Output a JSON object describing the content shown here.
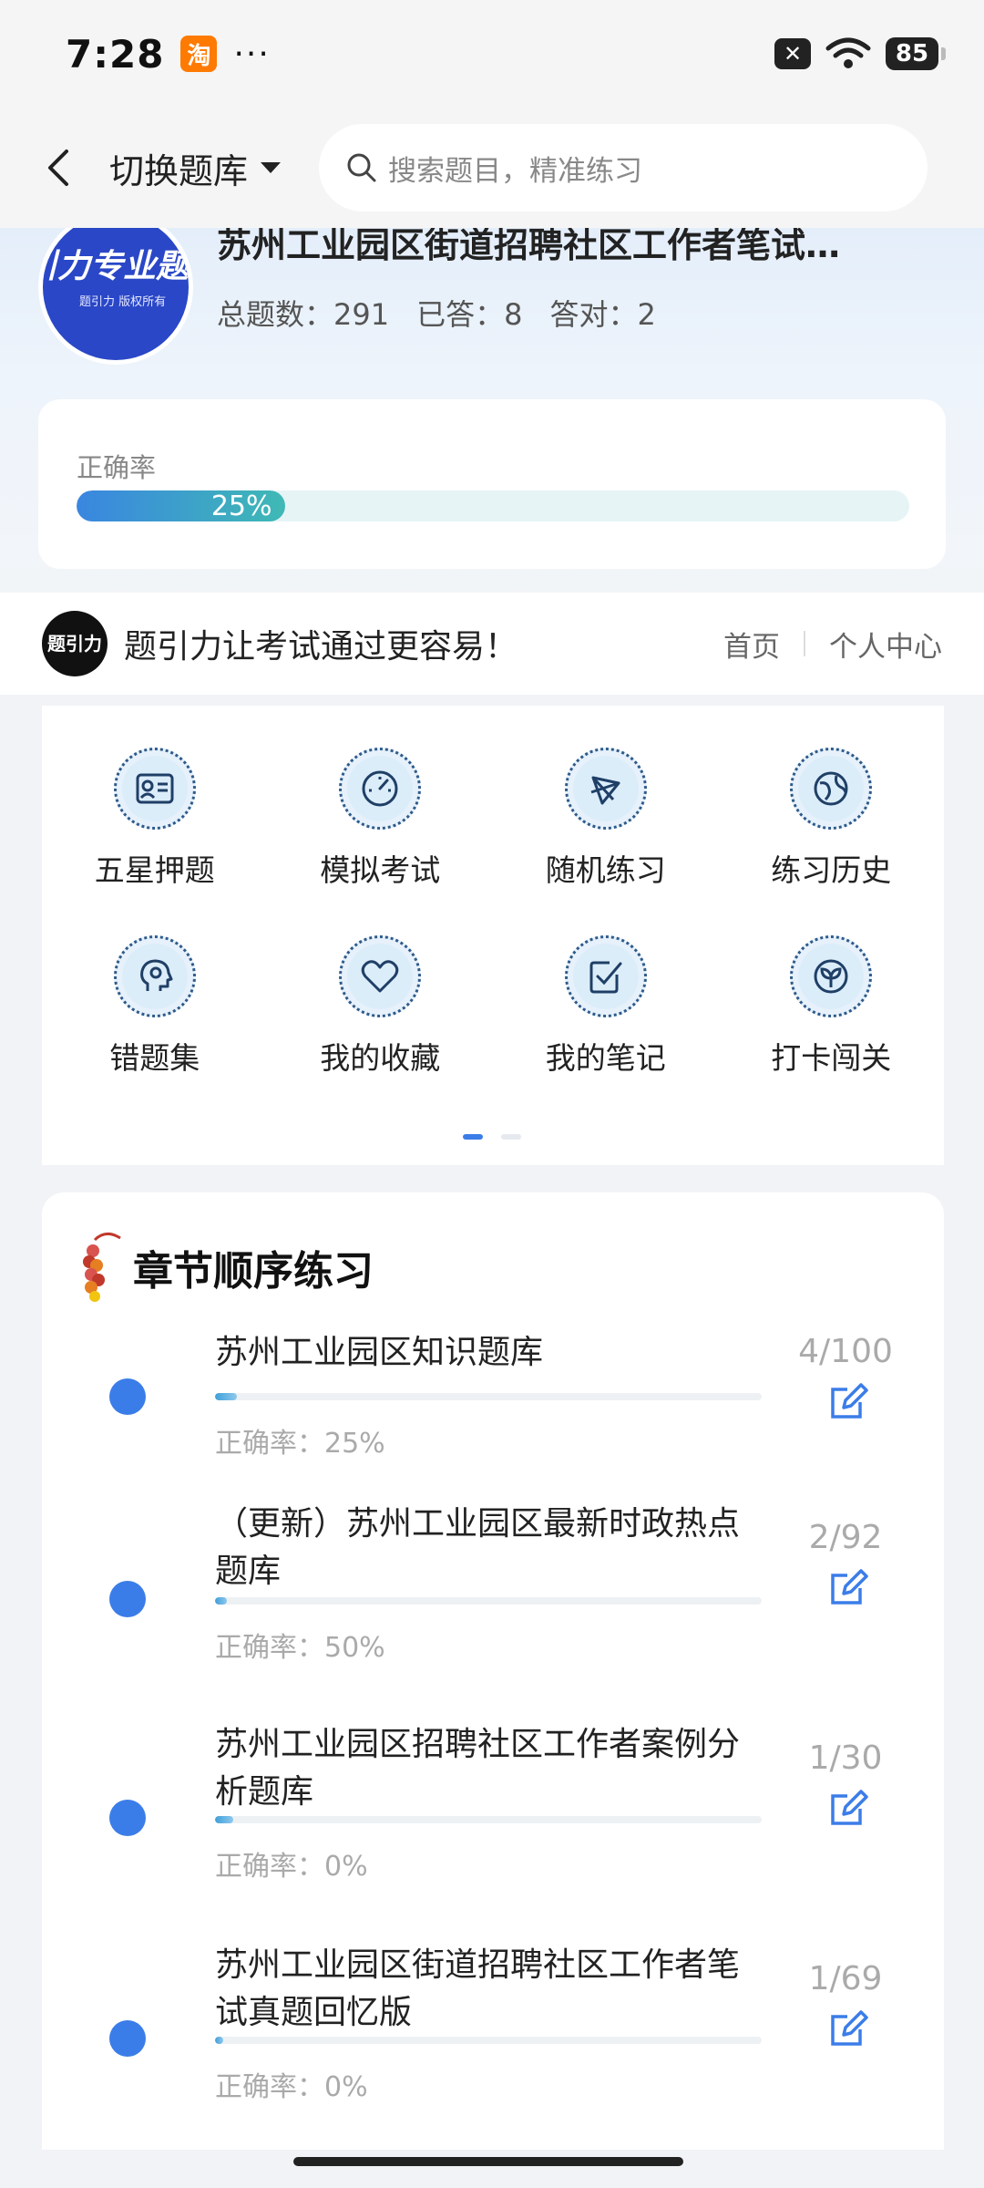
{
  "status_bar": {
    "time": "7:28",
    "app_badge": "淘",
    "dots": "···",
    "battery": "85"
  },
  "nav": {
    "switch_label": "切换题库",
    "search_placeholder": "搜索题目，精准练习"
  },
  "bank": {
    "logo_text": "引力专业题",
    "logo_sub": "题引力 版权所有",
    "title": "苏州工业园区街道招聘社区工作者笔试…",
    "stats": {
      "total": "总题数：291",
      "answered": "已答：8",
      "correct": "答对：2"
    },
    "accuracy_label": "正确率",
    "accuracy_value": "25%",
    "accuracy_fraction": 0.25
  },
  "brand": {
    "logo": "题引力",
    "slogan": "题引力让考试通过更容易！",
    "home": "首页",
    "personal": "个人中心"
  },
  "features": [
    {
      "label": "五星押题",
      "icon": "id-card-icon"
    },
    {
      "label": "模拟考试",
      "icon": "speedometer-icon"
    },
    {
      "label": "随机练习",
      "icon": "shuffle-icon"
    },
    {
      "label": "练习历史",
      "icon": "globe-icon"
    },
    {
      "label": "错题集",
      "icon": "head-icon"
    },
    {
      "label": "我的收藏",
      "icon": "heart-icon"
    },
    {
      "label": "我的笔记",
      "icon": "note-check-icon"
    },
    {
      "label": "打卡闯关",
      "icon": "sprout-icon"
    }
  ],
  "pager": {
    "active_index": 0,
    "count": 2,
    "active_color": "#3b7de8",
    "inactive_color": "#e6e9ee"
  },
  "chapters": {
    "title": "章节顺序练习",
    "items": [
      {
        "name": "苏州工业园区知识题库",
        "accuracy": "正确率：25%",
        "count": "4/100",
        "progress": 0.04
      },
      {
        "name": "（更新）苏州工业园区最新时政热点题库",
        "accuracy": "正确率：50%",
        "count": "2/92",
        "progress": 0.022
      },
      {
        "name": "苏州工业园区招聘社区工作者案例分析题库",
        "accuracy": "正确率：0%",
        "count": "1/30",
        "progress": 0.033
      },
      {
        "name": "苏州工业园区街道招聘社区工作者笔试真题回忆版",
        "accuracy": "正确率：0%",
        "count": "1/69",
        "progress": 0.0145
      }
    ]
  },
  "colors": {
    "accent": "#3b7de8",
    "brand_blue": "#2a47c7"
  }
}
